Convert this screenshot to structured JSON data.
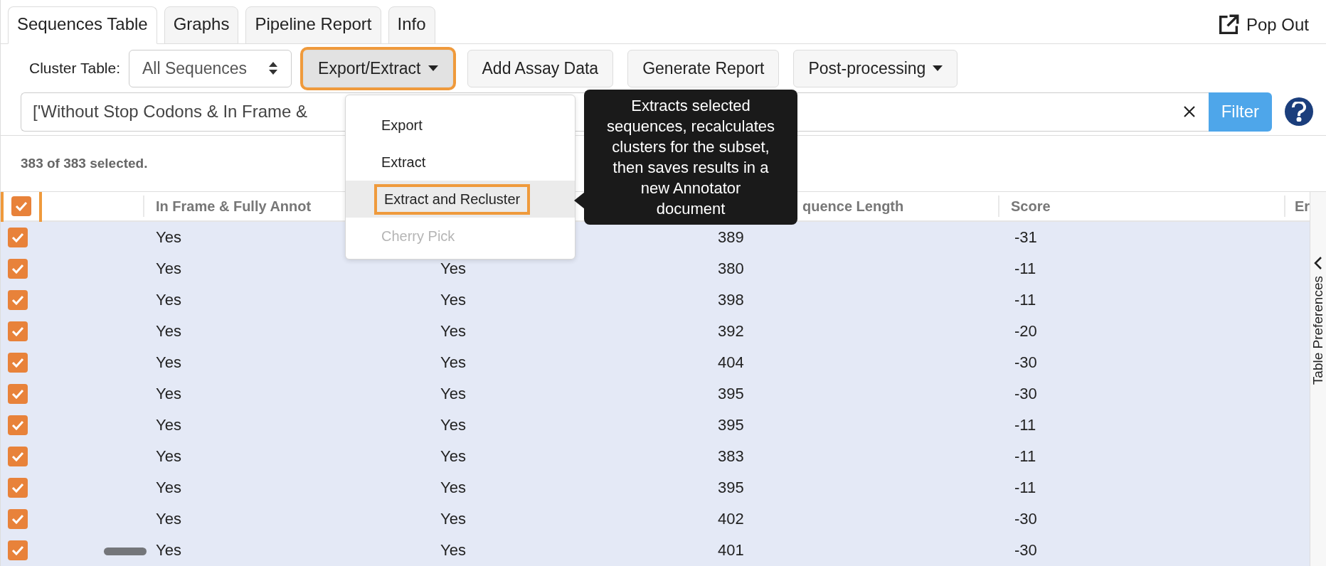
{
  "tabs": [
    {
      "label": "Sequences Table",
      "selected": true
    },
    {
      "label": "Graphs",
      "selected": false
    },
    {
      "label": "Pipeline Report",
      "selected": false
    },
    {
      "label": "Info",
      "selected": false
    }
  ],
  "pop_out": {
    "label": "Pop Out"
  },
  "toolbar": {
    "cluster_label": "Cluster Table:",
    "cluster_select": "All Sequences",
    "buttons": [
      {
        "label": "Export/Extract",
        "kind": "dropdown",
        "highlighted": true
      },
      {
        "label": "Add Assay Data",
        "kind": "plain",
        "highlighted": false
      },
      {
        "label": "Generate Report",
        "kind": "plain",
        "highlighted": false
      },
      {
        "label": "Post-processing",
        "kind": "dropdown",
        "highlighted": false
      }
    ]
  },
  "filter": {
    "value": "['Without Stop Codons & In Frame &",
    "button": "Filter"
  },
  "selection_status": "383 of 383 selected.",
  "table": {
    "select_all": {
      "checked": true,
      "highlighted": true
    },
    "columns": [
      {
        "label": "In Frame & Fully Annot"
      },
      {},
      {
        "label": "quence Length"
      },
      {
        "label": "Score"
      },
      {
        "label": "Er"
      }
    ],
    "rows": [
      {
        "selected": true,
        "cells": [
          "Yes",
          null,
          "389",
          "-31"
        ]
      },
      {
        "selected": true,
        "cells": [
          "Yes",
          "Yes",
          "380",
          "-11"
        ]
      },
      {
        "selected": true,
        "cells": [
          "Yes",
          "Yes",
          "398",
          "-11"
        ]
      },
      {
        "selected": true,
        "cells": [
          "Yes",
          "Yes",
          "392",
          "-20"
        ]
      },
      {
        "selected": true,
        "cells": [
          "Yes",
          "Yes",
          "404",
          "-30"
        ]
      },
      {
        "selected": true,
        "cells": [
          "Yes",
          "Yes",
          "395",
          "-30"
        ]
      },
      {
        "selected": true,
        "cells": [
          "Yes",
          "Yes",
          "395",
          "-11"
        ]
      },
      {
        "selected": true,
        "cells": [
          "Yes",
          "Yes",
          "383",
          "-11"
        ]
      },
      {
        "selected": true,
        "cells": [
          "Yes",
          "Yes",
          "395",
          "-11"
        ]
      },
      {
        "selected": true,
        "cells": [
          "Yes",
          "Yes",
          "402",
          "-30"
        ]
      },
      {
        "selected": true,
        "cells": [
          "Yes",
          "Yes",
          "401",
          "-30"
        ]
      }
    ]
  },
  "side_panel": {
    "label": "Table Preferences"
  },
  "dropdown_menu": {
    "items": [
      {
        "label": "Export",
        "disabled": false,
        "highlighted": false
      },
      {
        "label": "Extract",
        "disabled": false,
        "highlighted": false
      },
      {
        "label": "Extract and Recluster",
        "disabled": false,
        "highlighted": true
      },
      {
        "label": "Cherry Pick",
        "disabled": true,
        "highlighted": false
      }
    ]
  },
  "tooltip": {
    "text": "Extracts selected sequences, recalculates clusters for the subset, then saves results in a new Annotator document"
  }
}
